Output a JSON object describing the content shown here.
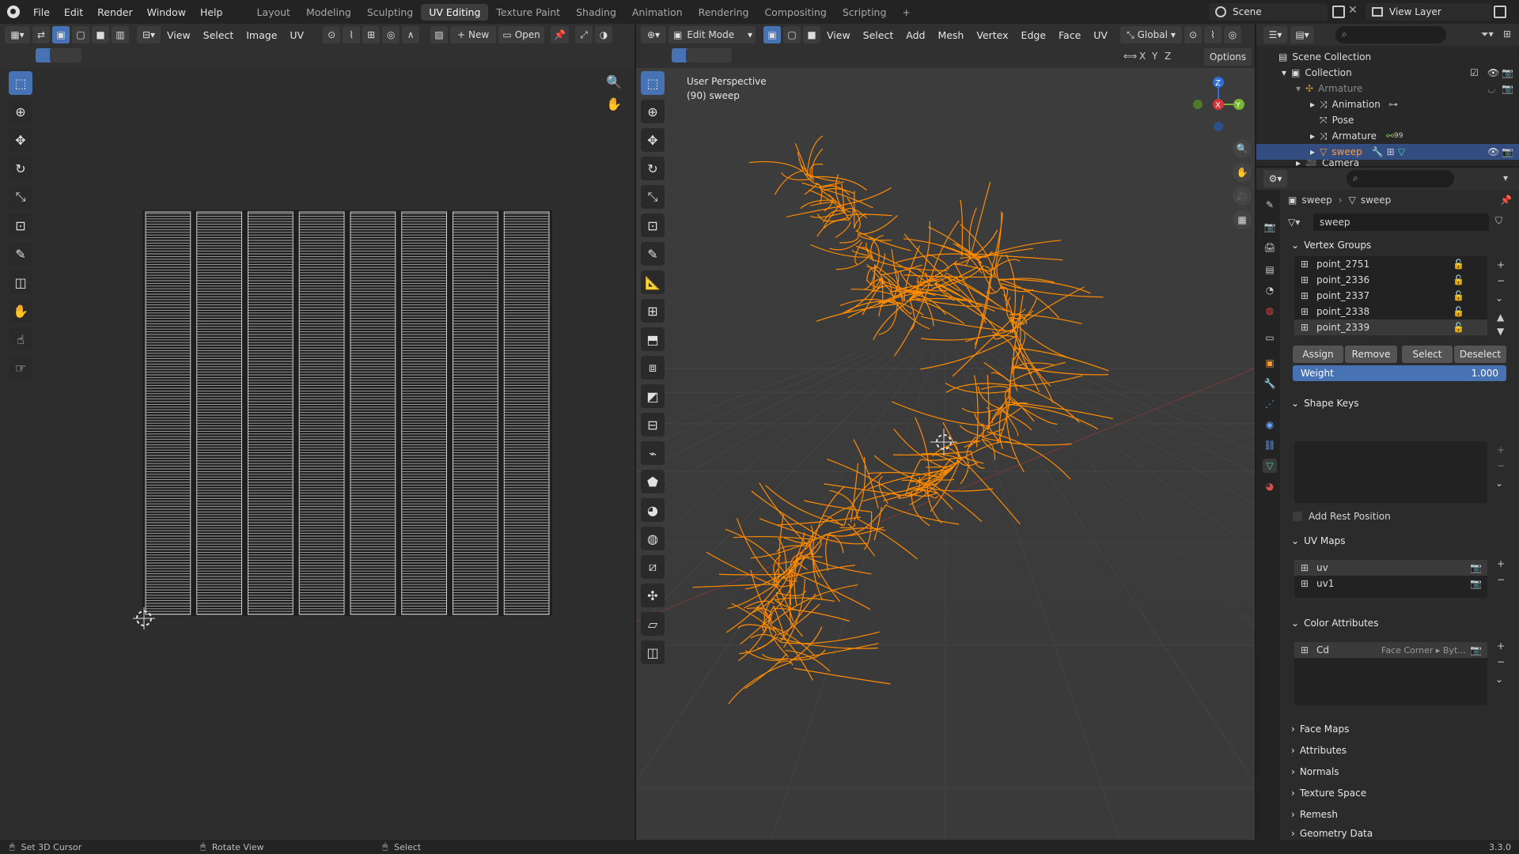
{
  "topbar": {
    "menus": [
      "File",
      "Edit",
      "Render",
      "Window",
      "Help"
    ],
    "workspaces": [
      "Layout",
      "Modeling",
      "Sculpting",
      "UV Editing",
      "Texture Paint",
      "Shading",
      "Animation",
      "Rendering",
      "Compositing",
      "Scripting"
    ],
    "active_workspace": "UV Editing",
    "add_tab": "+",
    "scene_label": "Scene",
    "view_layer_label": "View Layer"
  },
  "uv_editor": {
    "menus": [
      "View",
      "Select",
      "Image",
      "UV"
    ],
    "new_label": "New",
    "open_label": "Open"
  },
  "viewport": {
    "mode_label": "Edit Mode",
    "menus": [
      "View",
      "Select",
      "Add",
      "Mesh",
      "Vertex",
      "Edge",
      "Face",
      "UV"
    ],
    "orientation": "Global",
    "options_label": "Options",
    "axes": [
      "X",
      "Y",
      "Z"
    ],
    "overlay_line1": "User Perspective",
    "overlay_line2": "(90) sweep",
    "gizmo_labels": {
      "x": "X",
      "y": "Y",
      "z": "Z"
    }
  },
  "outliner": {
    "items": [
      {
        "label": "Scene Collection",
        "depth": 0
      },
      {
        "label": "Collection",
        "depth": 1
      },
      {
        "label": "Armature",
        "depth": 2,
        "muted": true
      },
      {
        "label": "Animation",
        "depth": 3
      },
      {
        "label": "Pose",
        "depth": 3
      },
      {
        "label": "Armature",
        "depth": 3
      },
      {
        "label": "sweep",
        "depth": 3,
        "selected": true
      },
      {
        "label": "Camera",
        "depth": 2
      }
    ],
    "armature_badge": "99"
  },
  "properties": {
    "breadcrumb_object": "sweep",
    "breadcrumb_data": "sweep",
    "data_name": "sweep",
    "vertex_groups_title": "Vertex Groups",
    "vertex_groups": [
      "point_2751",
      "point_2336",
      "point_2337",
      "point_2338",
      "point_2339"
    ],
    "assign_label": "Assign",
    "remove_label": "Remove",
    "select_label": "Select",
    "deselect_label": "Deselect",
    "weight_label": "Weight",
    "weight_value": "1.000",
    "shape_keys_title": "Shape Keys",
    "add_rest_position": "Add Rest Position",
    "uv_maps_title": "UV Maps",
    "uv_maps": [
      "uv",
      "uv1"
    ],
    "color_attributes_title": "Color Attributes",
    "color_attribute_name": "Cd",
    "color_attribute_domain": "Face Corner ▸ Byt...",
    "collapsed_panels": [
      "Face Maps",
      "Attributes",
      "Normals",
      "Texture Space",
      "Remesh",
      "Geometry Data"
    ]
  },
  "statusbar": {
    "hint1": "Set 3D Cursor",
    "hint2": "Rotate View",
    "hint3": "Select",
    "version": "3.3.0"
  },
  "colors": {
    "accent": "#4772b3",
    "mesh": "#ff8c00",
    "selection": "#334d80"
  }
}
